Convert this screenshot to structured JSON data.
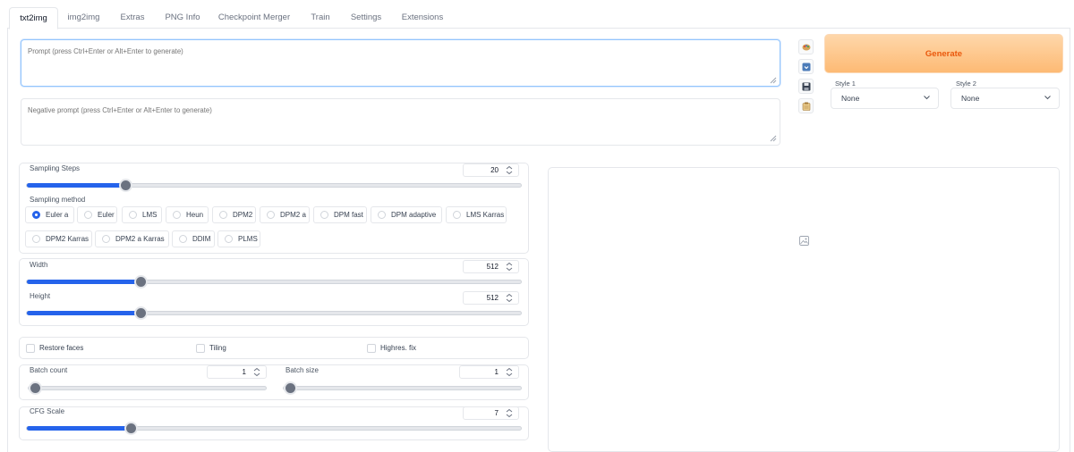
{
  "tabs": [
    {
      "label": "txt2img",
      "active": true
    },
    {
      "label": "img2img"
    },
    {
      "label": "Extras"
    },
    {
      "label": "PNG Info"
    },
    {
      "label": "Checkpoint Merger"
    },
    {
      "label": "Train"
    },
    {
      "label": "Settings"
    },
    {
      "label": "Extensions"
    }
  ],
  "prompt": {
    "placeholder": "Prompt (press Ctrl+Enter or Alt+Enter to generate)",
    "value": ""
  },
  "negative_prompt": {
    "placeholder": "Negative prompt (press Ctrl+Enter or Alt+Enter to generate)",
    "value": ""
  },
  "tools": [
    "paint-palette-icon",
    "arrow-down-box-icon",
    "save-floppy-icon",
    "clipboard-icon"
  ],
  "generate": {
    "label": "Generate"
  },
  "styles": [
    {
      "label": "Style 1",
      "value": "None"
    },
    {
      "label": "Style 2",
      "value": "None"
    }
  ],
  "sampling": {
    "steps_label": "Sampling Steps",
    "steps_value": "20",
    "steps_fraction": 0.2,
    "method_label": "Sampling method",
    "methods": [
      "Euler a",
      "Euler",
      "LMS",
      "Heun",
      "DPM2",
      "DPM2 a",
      "DPM fast",
      "DPM adaptive",
      "LMS Karras",
      "DPM2 Karras",
      "DPM2 a Karras",
      "DDIM",
      "PLMS"
    ],
    "selected": "Euler a"
  },
  "size": {
    "width_label": "Width",
    "width_value": "512",
    "width_fraction": 0.23,
    "height_label": "Height",
    "height_value": "512",
    "height_fraction": 0.23
  },
  "options": [
    "Restore faces",
    "Tiling",
    "Highres. fix"
  ],
  "batch": {
    "count_label": "Batch count",
    "count_value": "1",
    "count_fraction": 0.0,
    "size_label": "Batch size",
    "size_value": "1",
    "size_fraction": 0.0
  },
  "cfg": {
    "label": "CFG Scale",
    "value": "7",
    "fraction": 0.21
  },
  "colors": {
    "accent": "#2563eb",
    "generate_text": "#ea580c",
    "generate_bg": "#fdba74"
  }
}
